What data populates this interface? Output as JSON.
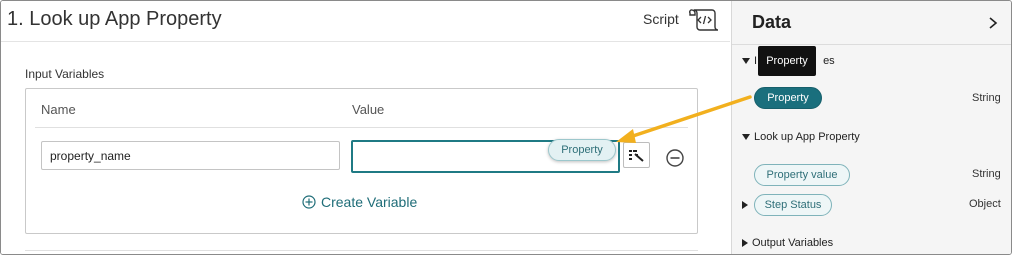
{
  "step": {
    "title": "1.  Look up App Property",
    "script_label": "Script"
  },
  "input_variables": {
    "section_label": "Input Variables",
    "columns": {
      "name": "Name",
      "value": "Value"
    },
    "row": {
      "name_value": "property_name",
      "value_value": "",
      "dragged_chip": "Property"
    },
    "create_label": "Create Variable"
  },
  "data_panel": {
    "title": "Data",
    "tooltip": "Property",
    "input_group": {
      "label_visible": "I",
      "label_tail": "es",
      "items": [
        {
          "chip": "Property",
          "type": "String"
        }
      ]
    },
    "lookup_group": {
      "label": "Look up App Property",
      "items": [
        {
          "chip": "Property value",
          "type": "String"
        },
        {
          "chip": "Step Status",
          "type": "Object"
        }
      ]
    },
    "output_group": {
      "label": "Output Variables"
    }
  },
  "colors": {
    "teal": "#1a6f7d",
    "teal_border": "#1f7a84",
    "annotation_arrow": "#f2b01e",
    "tooltip_bg": "#111111"
  },
  "icons": {
    "script": "script-scroll-icon",
    "picker": "data-picker-icon",
    "remove": "minus-circle-icon",
    "add": "plus-circle-icon",
    "collapse": "chevron-right-icon"
  }
}
